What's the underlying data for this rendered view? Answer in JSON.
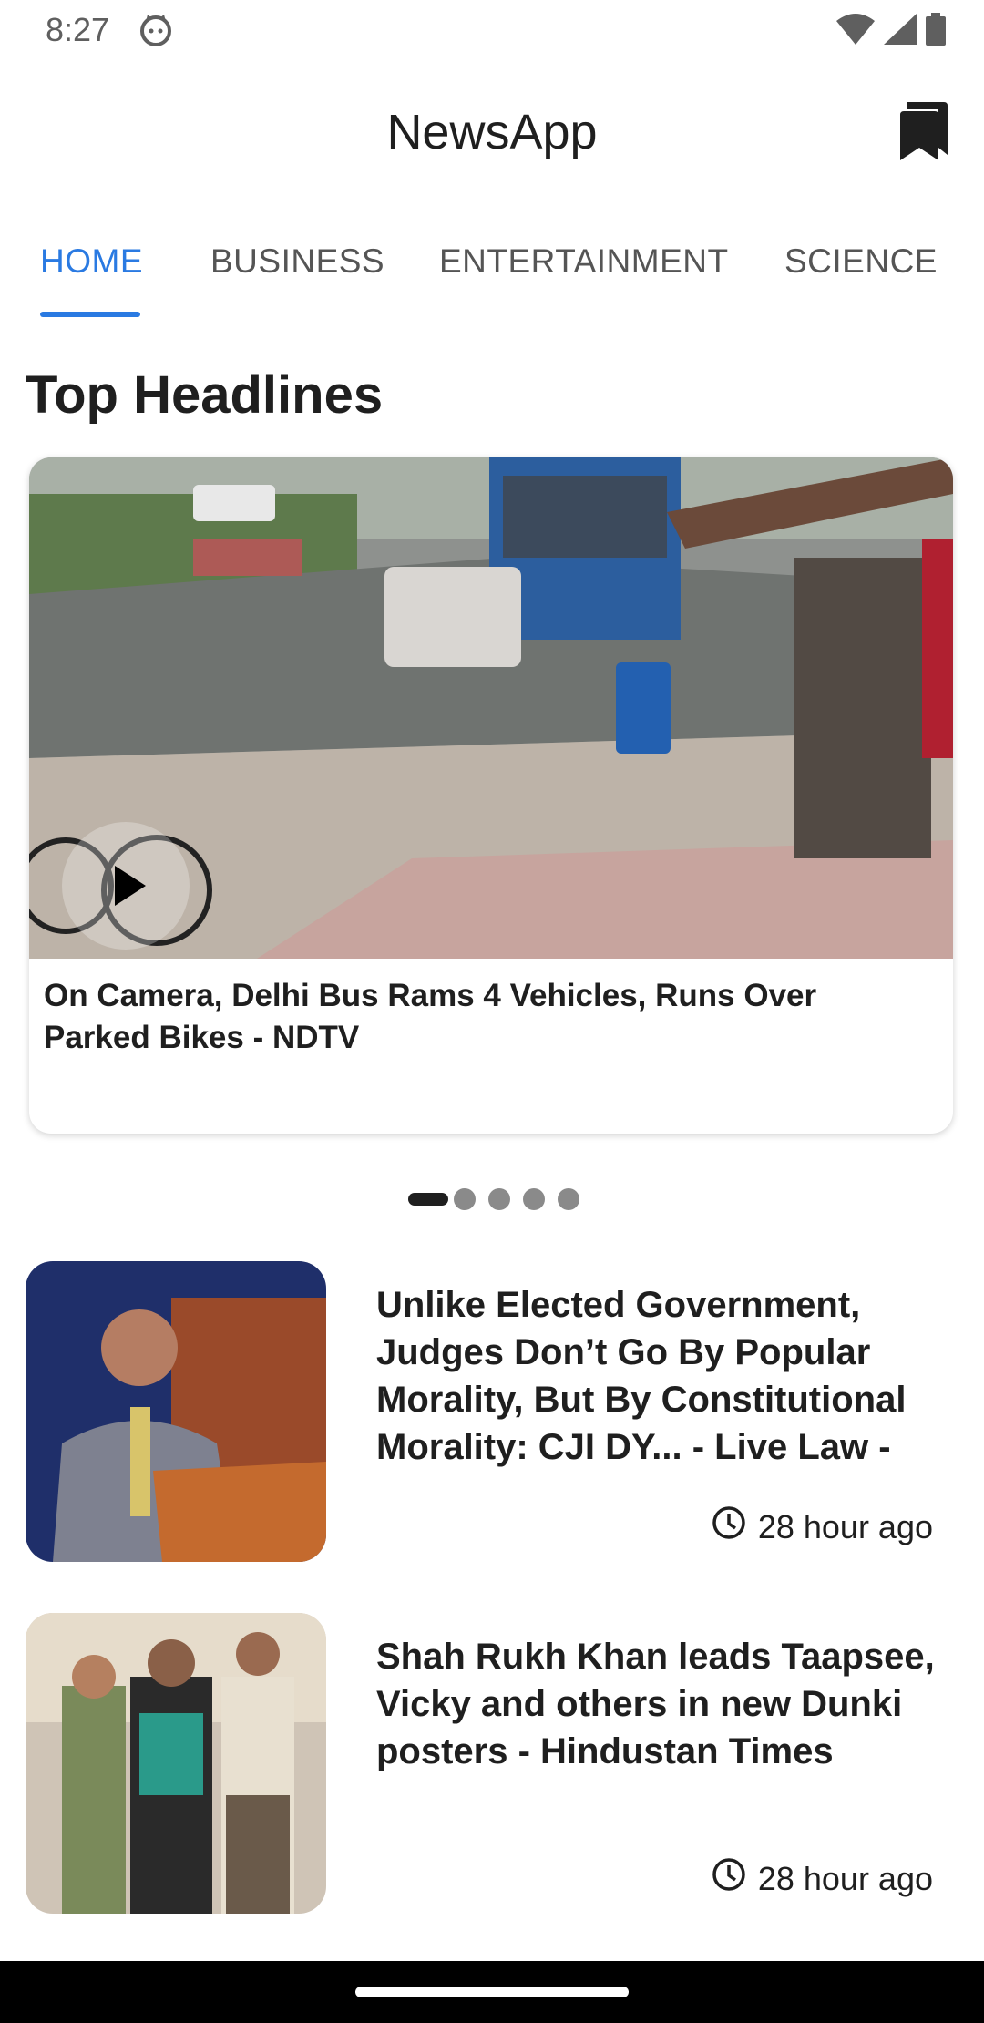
{
  "status_bar": {
    "time": "8:27"
  },
  "app": {
    "title": "NewsApp"
  },
  "tabs": [
    {
      "label": "HOME",
      "active": true
    },
    {
      "label": "BUSINESS",
      "active": false
    },
    {
      "label": "ENTERTAINMENT",
      "active": false
    },
    {
      "label": "SCIENCE",
      "active": false
    }
  ],
  "section": {
    "title": "Top Headlines"
  },
  "featured": {
    "title": "On Camera, Delhi Bus Rams 4 Vehicles, Runs Over Parked Bikes - NDTV"
  },
  "carousel": {
    "count": 5,
    "active_index": 0
  },
  "news": [
    {
      "title": "Unlike Elected Government, Judges Don’t Go By Popular Morality, But By Constitutional Morality: CJI DY... - Live Law -",
      "time": "28 hour ago"
    },
    {
      "title": "Shah Rukh Khan leads Taapsee, Vicky and others in new Dunki posters - Hindustan Times",
      "time": "28 hour ago"
    }
  ],
  "colors": {
    "accent": "#2a7ae2",
    "text": "#1f1f1f",
    "muted": "#555555"
  },
  "icons": [
    "cat-icon",
    "wifi-icon",
    "signal-icon",
    "battery-icon",
    "bookmark-icon",
    "play-icon",
    "clock-icon"
  ]
}
